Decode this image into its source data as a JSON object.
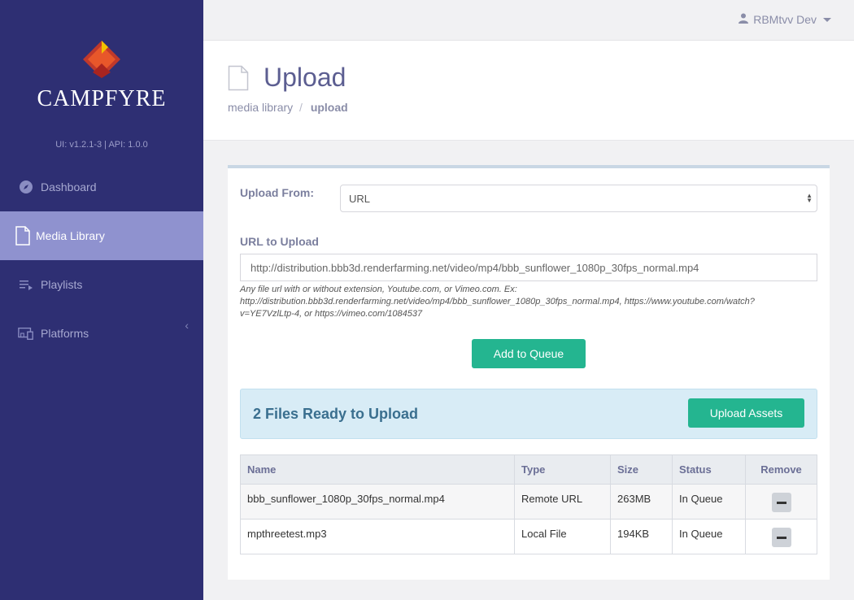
{
  "sidebar": {
    "brand": "CAMPFYRE",
    "version": "UI: v1.2.1-3  |  API: 1.0.0",
    "items": [
      {
        "label": "Dashboard",
        "icon": "compass-icon"
      },
      {
        "label": "Media Library",
        "icon": "file-icon",
        "active": true
      },
      {
        "label": "Playlists",
        "icon": "playlist-icon"
      },
      {
        "label": "Platforms",
        "icon": "devices-icon"
      }
    ],
    "collapse_icon": "chevron-left-icon"
  },
  "topbar": {
    "user_name": "RBMtvv Dev"
  },
  "header": {
    "title": "Upload",
    "breadcrumb": {
      "parent": "media library",
      "separator": "/",
      "current": "upload"
    }
  },
  "form": {
    "upload_from_label": "Upload From:",
    "upload_from_value": "URL",
    "url_label": "URL to Upload",
    "url_value": "http://distribution.bbb3d.renderfarming.net/video/mp4/bbb_sunflower_1080p_30fps_normal.mp4",
    "help_text": "Any file url with or without extension, Youtube.com, or Vimeo.com. Ex: http://distribution.bbb3d.renderfarming.net/video/mp4/bbb_sunflower_1080p_30fps_normal.mp4, https://www.youtube.com/watch?v=YE7VzlLtp-4, or https://vimeo.com/1084537",
    "add_button": "Add to Queue"
  },
  "queue": {
    "ready_text": "2 Files Ready to Upload",
    "upload_button": "Upload Assets",
    "columns": [
      "Name",
      "Type",
      "Size",
      "Status",
      "Remove"
    ],
    "rows": [
      {
        "name": "bbb_sunflower_1080p_30fps_normal.mp4",
        "type": "Remote URL",
        "size": "263MB",
        "status": "In Queue"
      },
      {
        "name": "mpthreetest.mp3",
        "type": "Local File",
        "size": "194KB",
        "status": "In Queue"
      }
    ]
  },
  "colors": {
    "sidebar_bg": "#2e2f73",
    "sidebar_active": "#8f92cf",
    "accent_green": "#24b590",
    "info_bg": "#d8ecf6"
  }
}
